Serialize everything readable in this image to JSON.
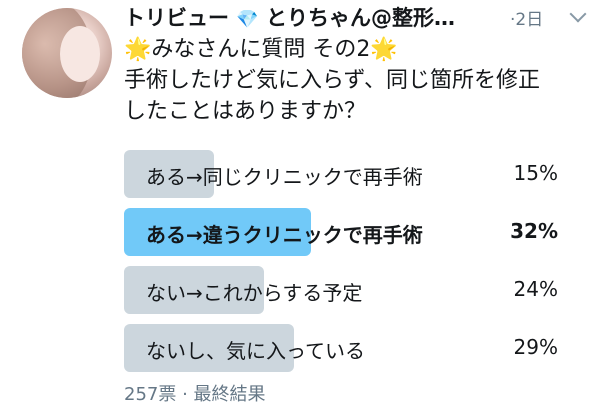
{
  "header": {
    "name_prefix": "トリビュー",
    "gem_icon": "💎",
    "name_suffix": "とりちゃん@整形…",
    "time": "·2日"
  },
  "tweet": {
    "star_icon": "🌟",
    "question_title": "みなさんに質問 その2",
    "question_line1": "手術したけど気に入らず、同じ箇所を修正",
    "question_line2": "したことはありますか？"
  },
  "poll": {
    "options": [
      {
        "label": "ある→同じクリニックで再手術",
        "percent": "15%",
        "fraction": 0.15
      },
      {
        "label": "ある→違うクリニックで再手術",
        "percent": "32%",
        "fraction": 0.32
      },
      {
        "label": "ない→これからする予定",
        "percent": "24%",
        "fraction": 0.24
      },
      {
        "label": "ないし、気に入っている",
        "percent": "29%",
        "fraction": 0.29
      }
    ],
    "winner_index": 1,
    "meta": "257票 · 最終結果"
  },
  "colors": {
    "bar": "#ccd6dd",
    "winner_bar": "#71c9f8",
    "muted_text": "#657786"
  }
}
